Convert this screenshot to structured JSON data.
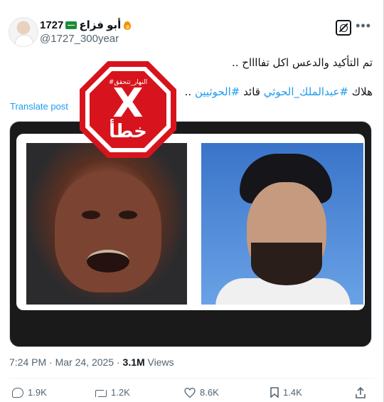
{
  "author": {
    "display_name": "أبو فزاع",
    "display_name_suffix": "1727",
    "handle": "@1727_300year"
  },
  "tweet": {
    "line1": "تم التأكيد والدعس اكل تفااااح ..",
    "line2_prefix": "هلاك ",
    "hashtag1": "#عبدالملك_الحوثي",
    "line2_mid": " قائد ",
    "hashtag2": "#الحوثيين",
    "line2_suffix": " ..",
    "translate_label": "Translate post"
  },
  "stamp": {
    "tag": "#النهار_تتحقق",
    "mark": "X",
    "word": "خطأ"
  },
  "meta": {
    "time": "7:24 PM",
    "separator": " · ",
    "date": "Mar 24, 2025",
    "views_count": "3.1M",
    "views_label": " Views"
  },
  "actions": {
    "replies": "1.9K",
    "reposts": "1.2K",
    "likes": "8.6K",
    "bookmarks": "1.4K"
  },
  "icons": [
    "grok-icon",
    "more-icon",
    "reply-icon",
    "retweet-icon",
    "heart-icon",
    "bookmark-icon",
    "share-icon"
  ],
  "colors": {
    "accent": "#1d9bf0",
    "stamp_red": "#d7141d",
    "text": "#0f1419",
    "muted": "#536471"
  }
}
